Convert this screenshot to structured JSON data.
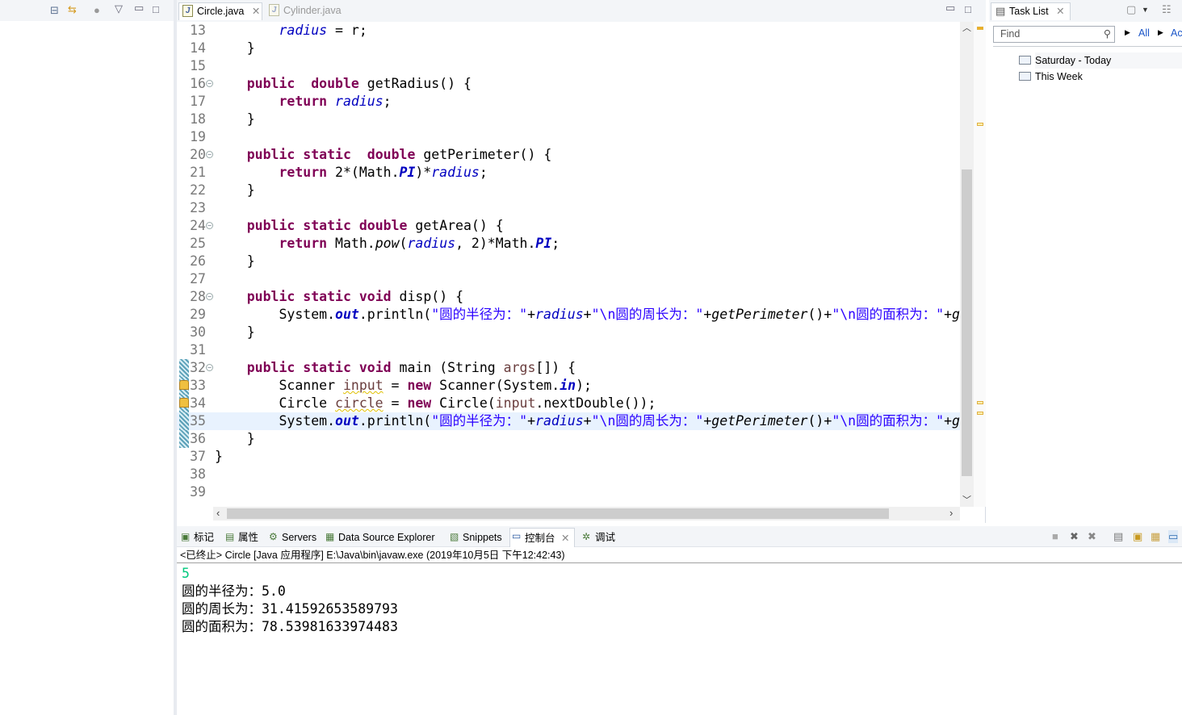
{
  "left_toolbar": {
    "icons": [
      "collapse-all-icon",
      "link-with-editor-icon",
      "filter-icon",
      "view-menu-icon",
      "minimize-icon",
      "maximize-icon"
    ]
  },
  "editor": {
    "tabs": [
      {
        "label": "Circle.java",
        "active": true,
        "close": "✕"
      },
      {
        "label": "Cylinder.java",
        "active": false
      }
    ],
    "current_line": 35,
    "lines": [
      {
        "n": "13",
        "t": [
          [
            "p",
            "        "
          ],
          [
            "fld",
            "radius"
          ],
          [
            "p",
            " = r;"
          ]
        ]
      },
      {
        "n": "14",
        "t": [
          [
            "p",
            "    }"
          ]
        ]
      },
      {
        "n": "15",
        "t": []
      },
      {
        "n": "16",
        "fold": true,
        "t": [
          [
            "p",
            "    "
          ],
          [
            "kw",
            "public"
          ],
          [
            "p",
            "  "
          ],
          [
            "kw",
            "double"
          ],
          [
            "p",
            " getRadius() {"
          ]
        ]
      },
      {
        "n": "17",
        "t": [
          [
            "p",
            "        "
          ],
          [
            "kw",
            "return"
          ],
          [
            "p",
            " "
          ],
          [
            "fld",
            "radius"
          ],
          [
            "p",
            ";"
          ]
        ]
      },
      {
        "n": "18",
        "t": [
          [
            "p",
            "    }"
          ]
        ]
      },
      {
        "n": "19",
        "t": []
      },
      {
        "n": "20",
        "fold": true,
        "t": [
          [
            "p",
            "    "
          ],
          [
            "kw",
            "public"
          ],
          [
            "p",
            " "
          ],
          [
            "kw",
            "static"
          ],
          [
            "p",
            "  "
          ],
          [
            "kw",
            "double"
          ],
          [
            "p",
            " getPerimeter() {"
          ]
        ]
      },
      {
        "n": "21",
        "t": [
          [
            "p",
            "        "
          ],
          [
            "kw",
            "return"
          ],
          [
            "p",
            " 2*(Math."
          ],
          [
            "sfld",
            "PI"
          ],
          [
            "p",
            ")*"
          ],
          [
            "fld",
            "radius"
          ],
          [
            "p",
            ";"
          ]
        ]
      },
      {
        "n": "22",
        "t": [
          [
            "p",
            "    }"
          ]
        ]
      },
      {
        "n": "23",
        "t": []
      },
      {
        "n": "24",
        "fold": true,
        "t": [
          [
            "p",
            "    "
          ],
          [
            "kw",
            "public"
          ],
          [
            "p",
            " "
          ],
          [
            "kw",
            "static"
          ],
          [
            "p",
            " "
          ],
          [
            "kw",
            "double"
          ],
          [
            "p",
            " getArea() {"
          ]
        ]
      },
      {
        "n": "25",
        "t": [
          [
            "p",
            "        "
          ],
          [
            "kw",
            "return"
          ],
          [
            "p",
            " Math."
          ],
          [
            "mth",
            "pow"
          ],
          [
            "p",
            "("
          ],
          [
            "fld",
            "radius"
          ],
          [
            "p",
            ", 2)*Math."
          ],
          [
            "sfld",
            "PI"
          ],
          [
            "p",
            ";"
          ]
        ]
      },
      {
        "n": "26",
        "t": [
          [
            "p",
            "    }"
          ]
        ]
      },
      {
        "n": "27",
        "t": []
      },
      {
        "n": "28",
        "fold": true,
        "t": [
          [
            "p",
            "    "
          ],
          [
            "kw",
            "public"
          ],
          [
            "p",
            " "
          ],
          [
            "kw",
            "static"
          ],
          [
            "p",
            " "
          ],
          [
            "kw",
            "void"
          ],
          [
            "p",
            " disp() {"
          ]
        ]
      },
      {
        "n": "29",
        "t": [
          [
            "p",
            "        System."
          ],
          [
            "sfld",
            "out"
          ],
          [
            "p",
            ".println("
          ],
          [
            "str",
            "\"圆的半径为：\""
          ],
          [
            "p",
            "+"
          ],
          [
            "fld",
            "radius"
          ],
          [
            "p",
            "+"
          ],
          [
            "str",
            "\"\\n圆的周长为：\""
          ],
          [
            "p",
            "+"
          ],
          [
            "mth",
            "getPerimeter"
          ],
          [
            "p",
            "()+"
          ],
          [
            "str",
            "\"\\n圆的面积为：\""
          ],
          [
            "p",
            "+"
          ],
          [
            "mth",
            "getArea"
          ],
          [
            "p",
            "());"
          ]
        ]
      },
      {
        "n": "30",
        "t": [
          [
            "p",
            "    }"
          ]
        ]
      },
      {
        "n": "31",
        "t": []
      },
      {
        "n": "32",
        "fold": true,
        "hatch": true,
        "t": [
          [
            "p",
            "    "
          ],
          [
            "kw",
            "public"
          ],
          [
            "p",
            " "
          ],
          [
            "kw",
            "static"
          ],
          [
            "p",
            " "
          ],
          [
            "kw",
            "void"
          ],
          [
            "p",
            " main (String "
          ],
          [
            "loc",
            "args"
          ],
          [
            "p",
            "[]) {"
          ]
        ]
      },
      {
        "n": "33",
        "hatch": true,
        "warning": true,
        "t": [
          [
            "p",
            "        Scanner "
          ],
          [
            "warn",
            "input"
          ],
          [
            "p",
            " = "
          ],
          [
            "kw",
            "new"
          ],
          [
            "p",
            " Scanner(System."
          ],
          [
            "sfld",
            "in"
          ],
          [
            "p",
            ");"
          ]
        ]
      },
      {
        "n": "34",
        "hatch": true,
        "warning": true,
        "t": [
          [
            "p",
            "        Circle "
          ],
          [
            "warn",
            "circle"
          ],
          [
            "p",
            " = "
          ],
          [
            "kw",
            "new"
          ],
          [
            "p",
            " Circle("
          ],
          [
            "loc",
            "input"
          ],
          [
            "p",
            ".nextDouble());"
          ]
        ]
      },
      {
        "n": "35",
        "hatch": true,
        "t": [
          [
            "p",
            "        System."
          ],
          [
            "sfld",
            "out"
          ],
          [
            "p",
            ".println("
          ],
          [
            "str",
            "\"圆的半径为：\""
          ],
          [
            "p",
            "+"
          ],
          [
            "fld",
            "radius"
          ],
          [
            "p",
            "+"
          ],
          [
            "str",
            "\"\\n圆的周长为：\""
          ],
          [
            "p",
            "+"
          ],
          [
            "mth",
            "getPerimeter"
          ],
          [
            "p",
            "()+"
          ],
          [
            "str",
            "\"\\n圆的面积为：\""
          ],
          [
            "p",
            "+"
          ],
          [
            "mth",
            "getArea"
          ],
          [
            "p",
            "());"
          ]
        ]
      },
      {
        "n": "36",
        "hatch": true,
        "t": [
          [
            "p",
            "    }"
          ]
        ]
      },
      {
        "n": "37",
        "t": [
          [
            "p",
            "}"
          ]
        ]
      },
      {
        "n": "38",
        "t": []
      },
      {
        "n": "39",
        "t": []
      }
    ]
  },
  "task_list": {
    "title": "Task List",
    "find_placeholder": "Find",
    "filters": [
      "All",
      "Ac"
    ],
    "groups": [
      "Saturday - Today",
      "This Week"
    ]
  },
  "bottom": {
    "tabs": [
      {
        "label": "标记",
        "icon": "markers-icon"
      },
      {
        "label": "属性",
        "icon": "properties-icon"
      },
      {
        "label": "Servers",
        "icon": "servers-icon"
      },
      {
        "label": "Data Source Explorer",
        "icon": "data-source-icon"
      },
      {
        "label": "Snippets",
        "icon": "snippets-icon"
      },
      {
        "label": "控制台",
        "icon": "console-icon",
        "active": true
      },
      {
        "label": "调试",
        "icon": "debug-icon"
      }
    ],
    "console_header": "<已终止> Circle [Java 应用程序] E:\\Java\\bin\\javaw.exe  (2019年10月5日 下午12:42:43)",
    "input_echo": "5",
    "input_color": "#00C87D",
    "output": [
      "圆的半径为：5.0",
      "圆的周长为：31.41592653589793",
      "圆的面积为：78.53981633974483"
    ]
  }
}
